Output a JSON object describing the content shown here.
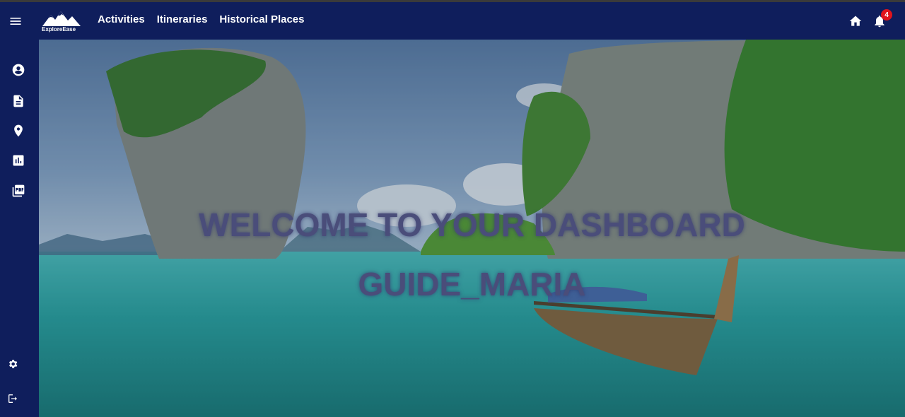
{
  "topbar": {
    "logo_text": "ExploreEase",
    "nav": [
      {
        "label": "Activities"
      },
      {
        "label": "Itineraries"
      },
      {
        "label": "Historical Places"
      }
    ],
    "notification_count": "4"
  },
  "sidebar": {
    "icons": [
      "account-icon",
      "document-icon",
      "location-icon",
      "report-icon",
      "pdf-icon",
      "settings-icon",
      "logout-icon"
    ]
  },
  "hero": {
    "line1": "WELCOME TO YOUR DASHBOARD",
    "line2": "GUIDE_MARIA"
  },
  "colors": {
    "nav_bg": "#0f1e5c",
    "badge": "#e0141c",
    "welcome_text": "#4a4d7a"
  }
}
